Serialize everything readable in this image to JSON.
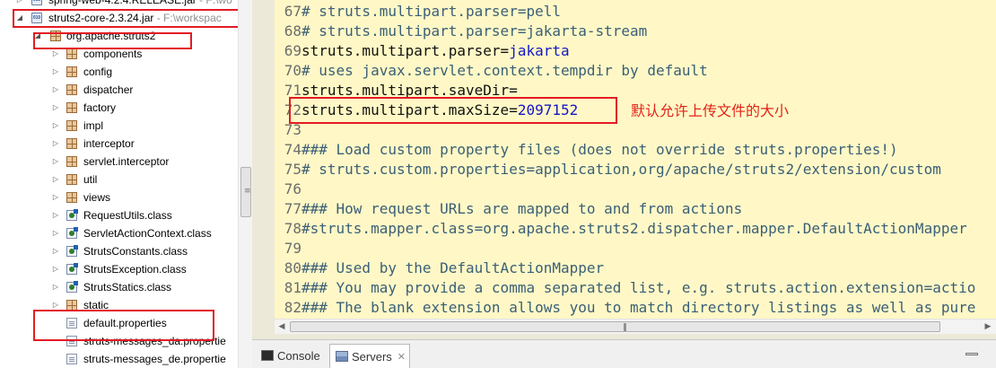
{
  "package_explorer": {
    "rows": [
      {
        "id": "spring-web",
        "label": "spring-web-4.2.4.RELEASE.jar",
        "path": " - F:\\wo",
        "type": "jar",
        "twisty": "▷"
      },
      {
        "id": "struts2-core",
        "label": "struts2-core-2.3.24.jar",
        "path": " - F:\\workspac",
        "type": "jar",
        "twisty": "◢"
      },
      {
        "id": "org-apache-struts2",
        "label": "org.apache.struts2",
        "type": "package",
        "twisty": "◢"
      },
      {
        "id": "components",
        "label": "components",
        "type": "package",
        "twisty": "▷"
      },
      {
        "id": "config",
        "label": "config",
        "type": "package",
        "twisty": "▷"
      },
      {
        "id": "dispatcher",
        "label": "dispatcher",
        "type": "package",
        "twisty": "▷"
      },
      {
        "id": "factory",
        "label": "factory",
        "type": "package",
        "twisty": "▷"
      },
      {
        "id": "impl",
        "label": "impl",
        "type": "package",
        "twisty": "▷"
      },
      {
        "id": "interceptor",
        "label": "interceptor",
        "type": "package",
        "twisty": "▷"
      },
      {
        "id": "servlet-interceptor",
        "label": "servlet.interceptor",
        "type": "package",
        "twisty": "▷"
      },
      {
        "id": "util",
        "label": "util",
        "type": "package",
        "twisty": "▷"
      },
      {
        "id": "views",
        "label": "views",
        "type": "package",
        "twisty": "▷"
      },
      {
        "id": "request-utils",
        "label": "RequestUtils.class",
        "type": "class",
        "twisty": "▷"
      },
      {
        "id": "servlet-action-context",
        "label": "ServletActionContext.class",
        "type": "class",
        "twisty": "▷"
      },
      {
        "id": "struts-constants",
        "label": "StrutsConstants.class",
        "type": "class",
        "twisty": "▷"
      },
      {
        "id": "struts-exception",
        "label": "StrutsException.class",
        "type": "class",
        "twisty": "▷"
      },
      {
        "id": "struts-statics",
        "label": "StrutsStatics.class",
        "type": "class",
        "twisty": "▷"
      },
      {
        "id": "static",
        "label": "static",
        "type": "package",
        "twisty": "▷"
      },
      {
        "id": "default-properties",
        "label": "default.properties",
        "type": "file",
        "twisty": ""
      },
      {
        "id": "struts-messages-da",
        "label": "struts-messages_da.propertie",
        "type": "file",
        "twisty": ""
      },
      {
        "id": "struts-messages-de",
        "label": "struts-messages_de.propertie",
        "type": "file",
        "twisty": ""
      }
    ]
  },
  "editor": {
    "lines": [
      {
        "n": "67",
        "parts": [
          {
            "t": "# struts.multipart.parser=pell",
            "c": "cm"
          }
        ]
      },
      {
        "n": "68",
        "parts": [
          {
            "t": "# struts.multipart.parser=jakarta-stream",
            "c": "cm"
          }
        ]
      },
      {
        "n": "69",
        "parts": [
          {
            "t": "struts.multipart.parser=",
            "c": "key"
          },
          {
            "t": "jakarta",
            "c": "val"
          }
        ]
      },
      {
        "n": "70",
        "parts": [
          {
            "t": "# uses javax.servlet.context.tempdir by default",
            "c": "cm"
          }
        ]
      },
      {
        "n": "71",
        "parts": [
          {
            "t": "struts.multipart.saveDir=",
            "c": "key"
          }
        ]
      },
      {
        "n": "72",
        "parts": [
          {
            "t": "struts.multipart.maxSize=",
            "c": "key"
          },
          {
            "t": "2097152",
            "c": "val"
          }
        ]
      },
      {
        "n": "73",
        "parts": []
      },
      {
        "n": "74",
        "parts": [
          {
            "t": "### Load custom property files (does not override struts.properties!)",
            "c": "cm"
          }
        ]
      },
      {
        "n": "75",
        "parts": [
          {
            "t": "# struts.custom.properties=application,org/apache/struts2/extension/custom",
            "c": "cm"
          }
        ]
      },
      {
        "n": "76",
        "parts": []
      },
      {
        "n": "77",
        "parts": [
          {
            "t": "### How request URLs are mapped to and from actions",
            "c": "cm"
          }
        ]
      },
      {
        "n": "78",
        "parts": [
          {
            "t": "#struts.mapper.class=org.apache.struts2.dispatcher.mapper.DefaultActionMapper",
            "c": "cm"
          }
        ]
      },
      {
        "n": "79",
        "parts": []
      },
      {
        "n": "80",
        "parts": [
          {
            "t": "### Used by the DefaultActionMapper",
            "c": "cm"
          }
        ]
      },
      {
        "n": "81",
        "parts": [
          {
            "t": "### You may provide a comma separated list, e.g. struts.action.extension=actio",
            "c": "cm"
          }
        ]
      },
      {
        "n": "82",
        "parts": [
          {
            "t": "### The blank extension allows you to match directory listings as well as pure",
            "c": "cm"
          }
        ]
      }
    ],
    "annotation": "默认允许上传文件的大小"
  },
  "bottom_tabs": {
    "console_label": "Console",
    "servers_label": "Servers",
    "close_glyph": "✕"
  },
  "colors": {
    "editor_bg": "#fff8c6",
    "highlight_box": "#e31b23",
    "comment": "#3b5f77",
    "value": "#1515c8",
    "annotation": "#e2231a"
  }
}
